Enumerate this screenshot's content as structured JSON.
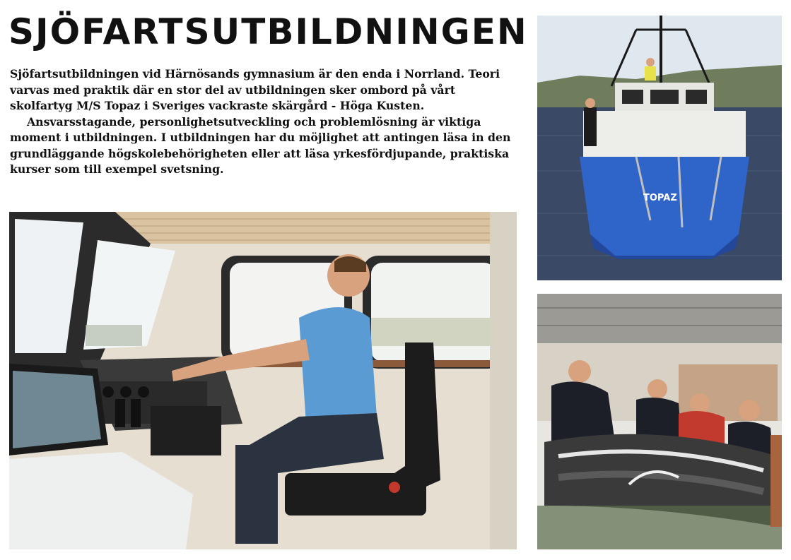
{
  "article": {
    "title": "SJÖFARTSUTBILDNINGEN",
    "paragraphs": [
      "Sjöfartsutbildningen vid Härnösands gymnasium är den enda i Norrland. Teori varvas med praktik där en stor del av utbildningen sker ombord på vårt skolfartyg M/S Topaz i Sveriges vackraste skärgård - Höga Kusten.",
      "Ansvarsstagande, personlighetsutveckling och problemlösning är viktiga moment i utbildningen. I utbildningen har du möjlighet att antingen läsa in den grundläggande högskolebehörigheten eller att läsa yrkesfördjupande, praktiska kurser som till exempel svetsning."
    ]
  },
  "photos": {
    "wheelhouse": {
      "colors": {
        "ceiling": "#d9c3a0",
        "frame": "#2b2b2b",
        "shirt": "#5a9bd3",
        "sky": "#eef2f4",
        "wall": "#e6ded0"
      }
    },
    "ship": {
      "hull_text": "TOPAZ",
      "colors": {
        "hull": "#2f64c8",
        "water": "#3a4a66",
        "sky": "#dfe8ee",
        "hills": "#6f7d5c"
      }
    },
    "engine": {
      "colors": {
        "room": "#e8e6e0",
        "engine": "#3a3a3a",
        "jacket": "#c23a2e"
      }
    }
  }
}
